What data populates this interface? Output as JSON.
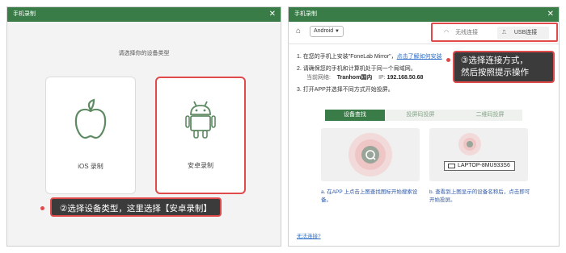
{
  "left_window": {
    "title": "手机录制",
    "prompt": "请选择你的设备类型",
    "ios_label": "iOS 录制",
    "android_label": "安卓录制",
    "callout": "②选择设备类型，这里选择【安卓录制】"
  },
  "right_window": {
    "title": "手机录制",
    "device_select": "Android",
    "connection_tabs": [
      "无线连接",
      "USB连接"
    ],
    "callout_line1": "③选择连接方式，",
    "callout_line2": "然后按照提示操作",
    "step1_text": "1. 在您的手机上安装\"FoneLab Mirror\"，",
    "step1_link": "点击了解如何安装",
    "step2_text": "2. 请确保您的手机和计算机处于同一个局域网。",
    "network_label": "当前网络:",
    "network_value": "Tranhom国内",
    "ip_label": "IP:",
    "ip_value": "192.168.50.68",
    "step3_text": "3. 打开APP并选择不同方式开始投屏。",
    "method_tabs": [
      "设备查找",
      "投屏码投屏",
      "二维码投屏"
    ],
    "device_name": "LAPTOP-8MU933S6",
    "desc_a": "a. 在APP 上点击上图查找图标开始搜索设备。",
    "desc_b": "b. 查看到上图显示的设备名称后，点击即可开始投屏。",
    "trouble_link": "无法连接?"
  },
  "colors": {
    "title_bar": "#3a7c48",
    "highlight": "#e04a4a",
    "android_green": "#5e8a63",
    "link": "#2f6fc7"
  }
}
